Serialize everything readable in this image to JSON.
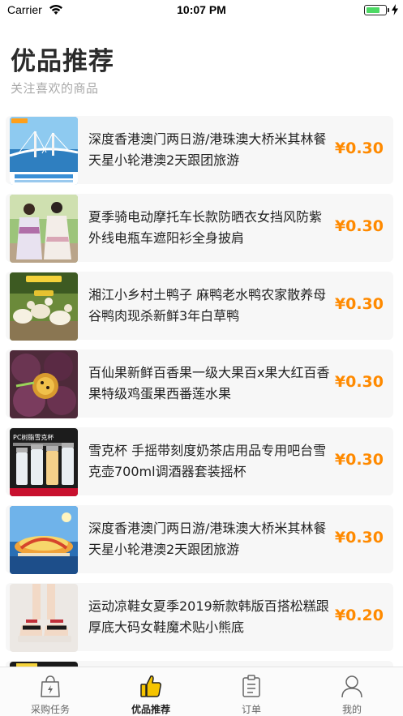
{
  "status_bar": {
    "carrier": "Carrier",
    "time": "10:07 PM",
    "battery_level": 0.75,
    "battery_color": "#4cd964"
  },
  "header": {
    "title": "优品推荐",
    "subtitle": "关注喜欢的商品"
  },
  "products": [
    {
      "title": "深度香港澳门两日游/港珠澳大桥米其林餐天星小轮港澳2天跟团旅游",
      "price": "¥0.30",
      "thumb": "bridge-tour"
    },
    {
      "title": "夏季骑电动摩托车长款防晒衣女挡风防紫外线电瓶车遮阳衫全身披肩",
      "price": "¥0.30",
      "thumb": "sun-cape"
    },
    {
      "title": "湘江小乡村土鸭子 麻鸭老水鸭农家散养母谷鸭肉现杀新鲜3年白草鸭",
      "price": "¥0.30",
      "thumb": "ducks"
    },
    {
      "title": "百仙果新鲜百香果一级大果百x果大红百香果特级鸡蛋果西番莲水果",
      "price": "¥0.30",
      "thumb": "passion-fruit"
    },
    {
      "title": "雪克杯 手摇带刻度奶茶店用品专用吧台雪克壶700ml调酒器套装摇杯",
      "price": "¥0.30",
      "thumb": "shaker-cups"
    },
    {
      "title": "深度香港澳门两日游/港珠澳大桥米其林餐天星小轮港澳2天跟团旅游",
      "price": "¥0.30",
      "thumb": "macau-tour"
    },
    {
      "title": "运动凉鞋女夏季2019新款韩版百搭松糕跟厚底大码女鞋魔术贴小熊底",
      "price": "¥0.20",
      "thumb": "sandals"
    },
    {
      "title": "",
      "price": "",
      "thumb": "partial"
    }
  ],
  "thumb_text": {
    "shaker_banner": "PC树脂雪克杯"
  },
  "colors": {
    "price": "#ff8a00",
    "tab_active_icon": "#f5c400"
  },
  "tabs": [
    {
      "label": "采购任务",
      "icon": "shopping-bag-icon",
      "active": false
    },
    {
      "label": "优品推荐",
      "icon": "thumbs-up-icon",
      "active": true
    },
    {
      "label": "订单",
      "icon": "clipboard-icon",
      "active": false
    },
    {
      "label": "我的",
      "icon": "person-icon",
      "active": false
    }
  ]
}
